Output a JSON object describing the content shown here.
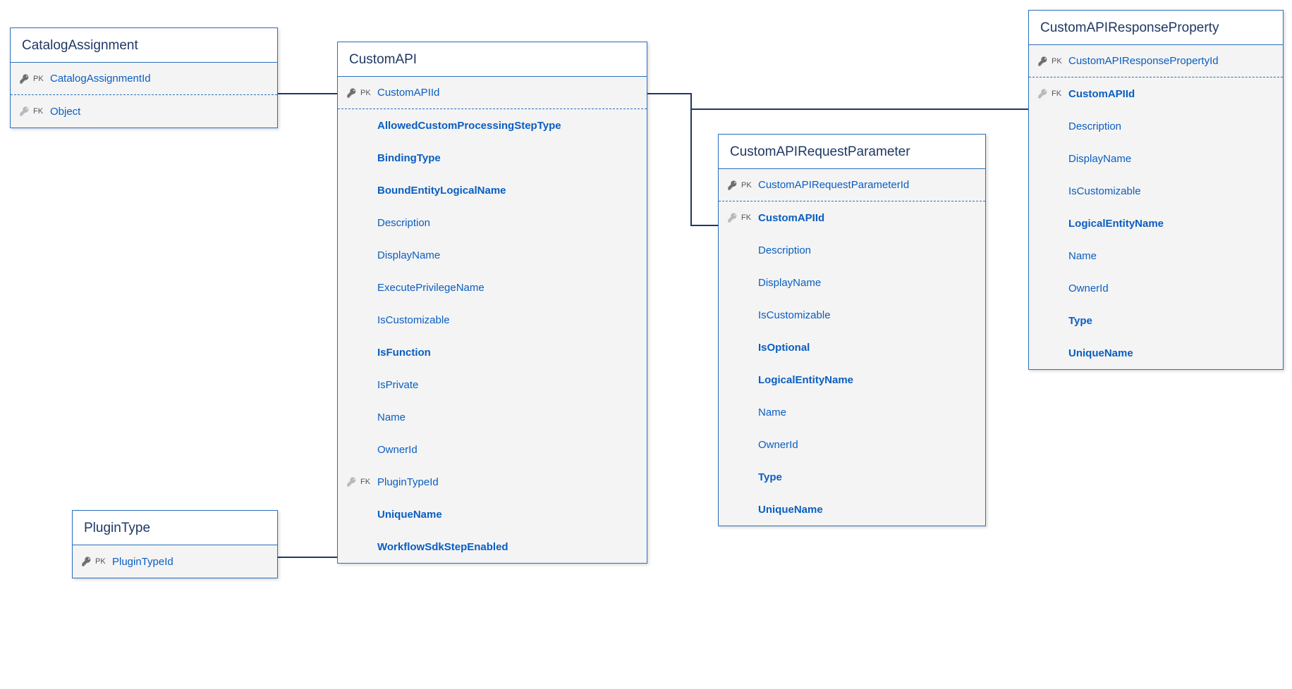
{
  "entities": {
    "catalogAssignment": {
      "title": "CatalogAssignment",
      "pk": "CatalogAssignmentId",
      "fk": "Object"
    },
    "pluginType": {
      "title": "PluginType",
      "pk": "PluginTypeId"
    },
    "customApi": {
      "title": "CustomAPI",
      "pk": "CustomAPIId",
      "fields": [
        {
          "name": "AllowedCustomProcessingStepType",
          "bold": true
        },
        {
          "name": "BindingType",
          "bold": true
        },
        {
          "name": "BoundEntityLogicalName",
          "bold": true
        },
        {
          "name": "Description",
          "bold": false
        },
        {
          "name": "DisplayName",
          "bold": false
        },
        {
          "name": "ExecutePrivilegeName",
          "bold": false
        },
        {
          "name": "IsCustomizable",
          "bold": false
        },
        {
          "name": "IsFunction",
          "bold": true
        },
        {
          "name": "IsPrivate",
          "bold": false
        },
        {
          "name": "Name",
          "bold": false
        },
        {
          "name": "OwnerId",
          "bold": false
        }
      ],
      "fkField": "PluginTypeId",
      "tailFields": [
        {
          "name": "UniqueName",
          "bold": true
        },
        {
          "name": "WorkflowSdkStepEnabled",
          "bold": true
        }
      ]
    },
    "requestParam": {
      "title": "CustomAPIRequestParameter",
      "pk": "CustomAPIRequestParameterId",
      "fk": "CustomAPIId",
      "fields": [
        {
          "name": "Description",
          "bold": false
        },
        {
          "name": "DisplayName",
          "bold": false
        },
        {
          "name": "IsCustomizable",
          "bold": false
        },
        {
          "name": "IsOptional",
          "bold": true
        },
        {
          "name": "LogicalEntityName",
          "bold": true
        },
        {
          "name": "Name",
          "bold": false
        },
        {
          "name": "OwnerId",
          "bold": false
        },
        {
          "name": "Type",
          "bold": true
        },
        {
          "name": "UniqueName",
          "bold": true
        }
      ]
    },
    "responseProp": {
      "title": "CustomAPIResponseProperty",
      "pk": "CustomAPIResponsePropertyId",
      "fk": "CustomAPIId",
      "fields": [
        {
          "name": "Description",
          "bold": false
        },
        {
          "name": "DisplayName",
          "bold": false
        },
        {
          "name": "IsCustomizable",
          "bold": false
        },
        {
          "name": "LogicalEntityName",
          "bold": true
        },
        {
          "name": "Name",
          "bold": false
        },
        {
          "name": "OwnerId",
          "bold": false
        },
        {
          "name": "Type",
          "bold": true
        },
        {
          "name": "UniqueName",
          "bold": true
        }
      ]
    }
  },
  "labels": {
    "pk": "PK",
    "fk": "FK"
  }
}
